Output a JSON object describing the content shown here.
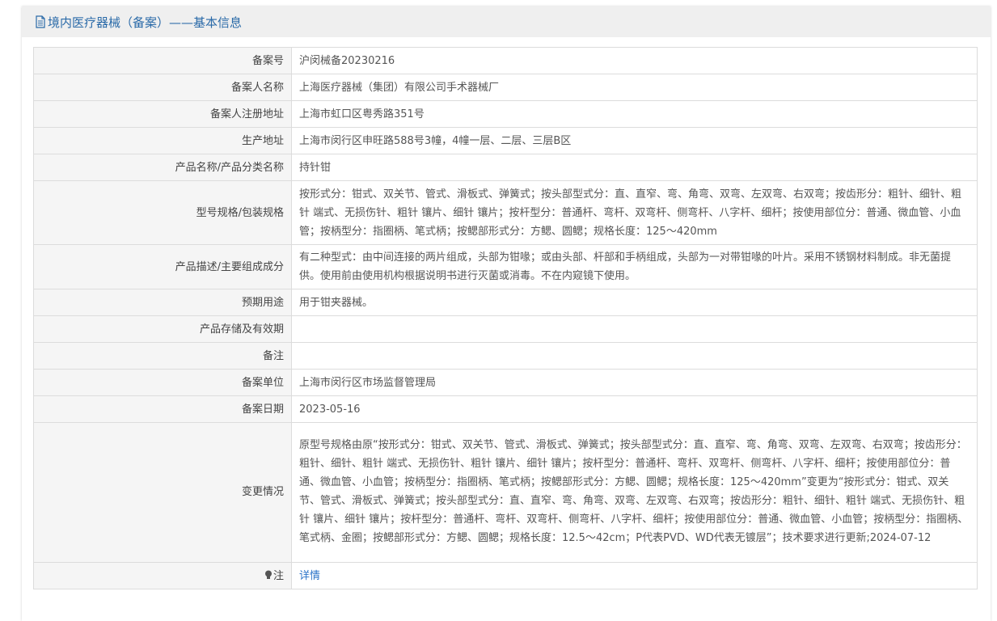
{
  "header": {
    "title": "境内医疗器械（备案）——基本信息",
    "icon": "document-icon",
    "accent": "#2a6aa8"
  },
  "rows": [
    {
      "label": "备案号",
      "value": "沪闵械备20230216"
    },
    {
      "label": "备案人名称",
      "value": "上海医疗器械（集团）有限公司手术器械厂"
    },
    {
      "label": "备案人注册地址",
      "value": "上海市虹口区粤秀路351号"
    },
    {
      "label": "生产地址",
      "value": "上海市闵行区申旺路588号3幢，4幢一层、二层、三层B区"
    },
    {
      "label": "产品名称/产品分类名称",
      "value": "持针钳"
    },
    {
      "label": "型号规格/包装规格",
      "value": "按形式分：钳式、双关节、管式、滑板式、弹簧式；按头部型式分：直、直窄、弯、角弯、双弯、左双弯、右双弯；按齿形分：粗针、细针、粗针 端式、无损伤针、粗针 镶片、细针 镶片；按杆型分：普通杆、弯杆、双弯杆、侧弯杆、八字杆、细杆；按使用部位分：普通、微血管、小血管；按柄型分：指圈柄、笔式柄；按鳃部形式分：方鳃、圆鳃；规格长度：125～420mm"
    },
    {
      "label": "产品描述/主要组成成分",
      "value": "有二种型式：由中间连接的两片组成，头部为钳喙；或由头部、杆部和手柄组成，头部为一对带钳喙的叶片。采用不锈钢材料制成。非无菌提供。使用前由使用机构根据说明书进行灭菌或消毒。不在内窥镜下使用。"
    },
    {
      "label": "预期用途",
      "value": "用于钳夹器械。"
    },
    {
      "label": "产品存储及有效期",
      "value": ""
    },
    {
      "label": "备注",
      "value": ""
    },
    {
      "label": "备案单位",
      "value": "上海市闵行区市场监督管理局"
    },
    {
      "label": "备案日期",
      "value": "2023-05-16"
    },
    {
      "label": "变更情况",
      "value": "原型号规格由原“按形式分：钳式、双关节、管式、滑板式、弹簧式；按头部型式分：直、直窄、弯、角弯、双弯、左双弯、右双弯；按齿形分：粗针、细针、粗针 端式、无损伤针、粗针 镶片、细针 镶片；按杆型分：普通杆、弯杆、双弯杆、侧弯杆、八字杆、细杆；按使用部位分：普通、微血管、小血管；按柄型分：指圈柄、笔式柄；按鳃部形式分：方鳃、圆鳃；规格长度：125～420mm”变更为“按形式分：钳式、双关节、管式、滑板式、弹簧式；按头部型式分：直、直窄、弯、角弯、双弯、左双弯、右双弯；按齿形分：粗针、细针、粗针 端式、无损伤针、粗针 镶片、细针 镶片；按杆型分：普通杆、弯杆、双弯杆、侧弯杆、八字杆、细杆；按使用部位分：普通、微血管、小血管；按柄型分：指圈柄、笔式柄、金圈；按鳃部形式分：方鳃、圆鳃；规格长度：12.5～42cm；P代表PVD、WD代表无镀层”；技术要求进行更新;2024-07-12"
    },
    {
      "label": "注",
      "value": "详情",
      "icon": "lightbulb-icon"
    }
  ]
}
